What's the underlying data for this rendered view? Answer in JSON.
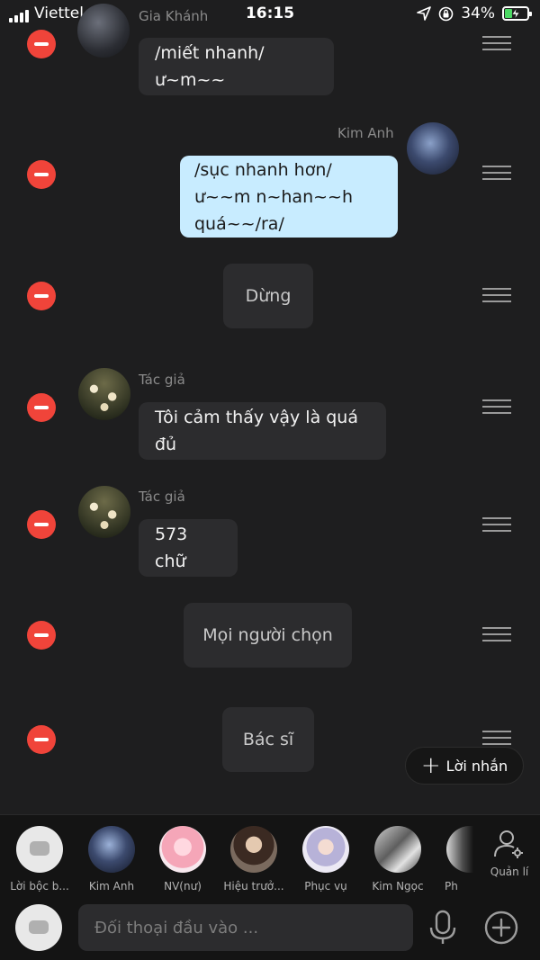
{
  "status": {
    "carrier": "Viettel",
    "time": "16:15",
    "battery_percent": "34%",
    "battery_level": 0.34,
    "icons": [
      "signal-icon",
      "wifi-icon",
      "location-icon",
      "lock-rotation-icon",
      "battery-charging-icon"
    ]
  },
  "messages": [
    {
      "kind": "other",
      "name": "Gia Khánh",
      "text": "/miết nhanh/ ư~m~~"
    },
    {
      "kind": "me",
      "name": "Kim Anh",
      "text": "/sục nhanh hơn/ ư~~m n~han~~h quá~~/ra/"
    },
    {
      "kind": "narration",
      "text": "Dừng"
    },
    {
      "kind": "other",
      "name": "Tác giả",
      "text": "Tôi cảm thấy vậy là quá đủ"
    },
    {
      "kind": "other",
      "name": "Tác giả",
      "text": "573 chữ"
    },
    {
      "kind": "narration",
      "text": "Mọi người chọn"
    },
    {
      "kind": "narration",
      "text": "Bác sĩ"
    }
  ],
  "fab": {
    "label": "Lời nhắn",
    "icon": "plus-icon"
  },
  "characters": [
    {
      "label": "Lời bộc b..."
    },
    {
      "label": "Kim Anh"
    },
    {
      "label": "NV(nư)"
    },
    {
      "label": "Hiệu trưở..."
    },
    {
      "label": "Phục vụ"
    },
    {
      "label": "Kim Ngọc"
    },
    {
      "label": "Ph"
    }
  ],
  "manage": {
    "label": "Quản lí",
    "icon": "user-settings-icon"
  },
  "input": {
    "placeholder": "Đối thoại đầu vào ...",
    "value": ""
  },
  "colors": {
    "background": "#1e1e1f",
    "bubble": "#2c2c2e",
    "my_bubble": "#c8ecff",
    "remove": "#f0443a",
    "charging": "#4cd964"
  }
}
